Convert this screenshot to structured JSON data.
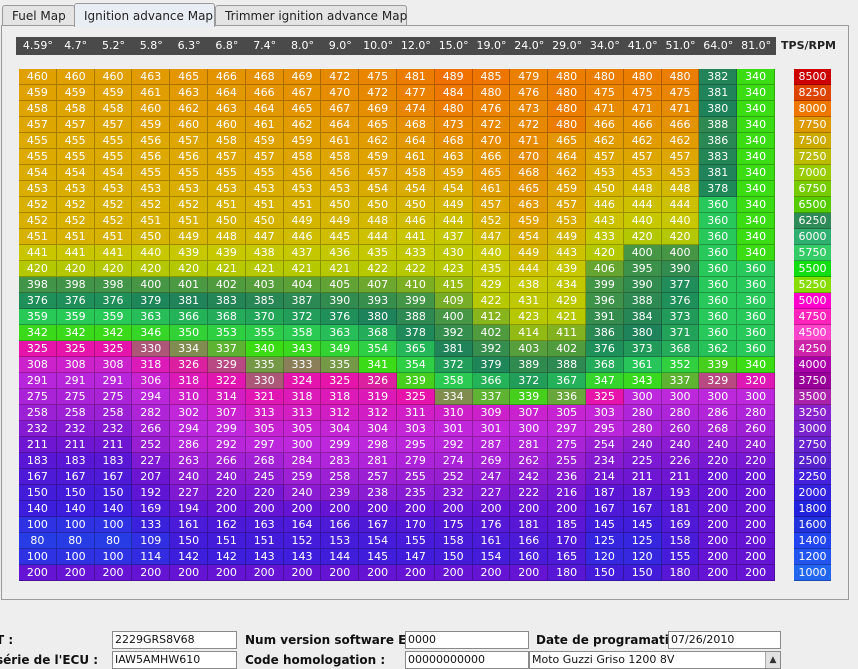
{
  "tabs": [
    {
      "label": "Fuel Map",
      "active": false
    },
    {
      "label": "Ignition advance Map",
      "active": true
    },
    {
      "label": "Trimmer ignition advance Map",
      "active": false
    }
  ],
  "axis_label": "TPS/RPM",
  "tps_header": [
    "4.59°",
    "4.7°",
    "5.2°",
    "5.8°",
    "6.3°",
    "6.8°",
    "7.4°",
    "8.0°",
    "9.0°",
    "10.0°",
    "12.0°",
    "15.0°",
    "19.0°",
    "24.0°",
    "29.0°",
    "34.0°",
    "41.0°",
    "51.0°",
    "64.0°",
    "81.0°"
  ],
  "rpm": [
    "8500",
    "8250",
    "8000",
    "7750",
    "7500",
    "7250",
    "7000",
    "6750",
    "6500",
    "6250",
    "6000",
    "5750",
    "5500",
    "5250",
    "5000",
    "4750",
    "4500",
    "4250",
    "4000",
    "3750",
    "3500",
    "3250",
    "3000",
    "2750",
    "2500",
    "2250",
    "2000",
    "1800",
    "1600",
    "1400",
    "1200",
    "1000"
  ],
  "rpm_colors": [
    "#cc0000",
    "#dd4400",
    "#ee7700",
    "#dd9900",
    "#ccaa00",
    "#bbbb00",
    "#99cc00",
    "#77cc00",
    "#55cc00",
    "#2e8b57",
    "#30b070",
    "#33cc66",
    "#11dd11",
    "#88dd00",
    "#ff00cc",
    "#ff22bb",
    "#ff44cc",
    "#cc22aa",
    "#aa00aa",
    "#990099",
    "#aa22aa",
    "#8822cc",
    "#7722cc",
    "#6622cc",
    "#5522cc",
    "#4422dd",
    "#3322dd",
    "#2222dd",
    "#2233dd",
    "#2244ee",
    "#2255ee",
    "#2266ee"
  ],
  "grid": [
    [
      460,
      460,
      460,
      463,
      465,
      466,
      468,
      469,
      472,
      475,
      481,
      489,
      485,
      479,
      480,
      480,
      480,
      480,
      382,
      340
    ],
    [
      459,
      459,
      459,
      461,
      463,
      464,
      466,
      467,
      470,
      472,
      477,
      484,
      480,
      476,
      480,
      475,
      475,
      475,
      381,
      340
    ],
    [
      458,
      458,
      458,
      460,
      462,
      463,
      464,
      465,
      467,
      469,
      474,
      480,
      476,
      473,
      480,
      471,
      471,
      471,
      380,
      340
    ],
    [
      457,
      457,
      457,
      459,
      460,
      460,
      461,
      462,
      464,
      465,
      468,
      473,
      472,
      472,
      480,
      466,
      466,
      466,
      388,
      340
    ],
    [
      455,
      455,
      455,
      456,
      457,
      458,
      459,
      459,
      461,
      462,
      464,
      468,
      470,
      471,
      465,
      462,
      462,
      462,
      386,
      340
    ],
    [
      455,
      455,
      455,
      456,
      456,
      457,
      457,
      458,
      458,
      459,
      461,
      463,
      466,
      470,
      464,
      457,
      457,
      457,
      383,
      340
    ],
    [
      454,
      454,
      454,
      455,
      455,
      455,
      455,
      456,
      456,
      457,
      458,
      459,
      465,
      468,
      462,
      453,
      453,
      453,
      381,
      340
    ],
    [
      453,
      453,
      453,
      453,
      453,
      453,
      453,
      453,
      453,
      454,
      454,
      454,
      461,
      465,
      459,
      450,
      448,
      448,
      378,
      340
    ],
    [
      452,
      452,
      452,
      452,
      452,
      451,
      451,
      451,
      450,
      450,
      450,
      449,
      457,
      463,
      457,
      446,
      444,
      444,
      360,
      340
    ],
    [
      452,
      452,
      452,
      451,
      451,
      450,
      450,
      449,
      449,
      448,
      446,
      444,
      452,
      459,
      453,
      443,
      440,
      440,
      360,
      340
    ],
    [
      451,
      451,
      451,
      450,
      449,
      448,
      447,
      446,
      445,
      444,
      441,
      437,
      447,
      454,
      449,
      433,
      420,
      420,
      360,
      340
    ],
    [
      441,
      441,
      441,
      440,
      439,
      439,
      438,
      437,
      436,
      435,
      433,
      430,
      440,
      449,
      443,
      420,
      400,
      400,
      360,
      340
    ],
    [
      420,
      420,
      420,
      420,
      420,
      421,
      421,
      421,
      421,
      422,
      422,
      423,
      435,
      444,
      439,
      406,
      395,
      390,
      360,
      360
    ],
    [
      398,
      398,
      398,
      400,
      401,
      402,
      403,
      404,
      405,
      407,
      410,
      415,
      429,
      438,
      434,
      399,
      390,
      377,
      360,
      360
    ],
    [
      376,
      376,
      376,
      379,
      381,
      383,
      385,
      387,
      390,
      393,
      399,
      409,
      422,
      431,
      429,
      396,
      388,
      376,
      360,
      360
    ],
    [
      359,
      359,
      359,
      363,
      366,
      368,
      370,
      372,
      376,
      380,
      388,
      400,
      412,
      423,
      421,
      391,
      384,
      373,
      360,
      360
    ],
    [
      342,
      342,
      342,
      346,
      350,
      353,
      355,
      358,
      363,
      368,
      378,
      392,
      402,
      414,
      411,
      386,
      380,
      371,
      360,
      360
    ],
    [
      325,
      325,
      325,
      330,
      334,
      337,
      340,
      343,
      349,
      354,
      365,
      381,
      392,
      403,
      402,
      376,
      373,
      368,
      362,
      360
    ],
    [
      308,
      308,
      308,
      318,
      326,
      329,
      335,
      333,
      335,
      341,
      354,
      372,
      379,
      389,
      388,
      368,
      361,
      352,
      339,
      340
    ],
    [
      291,
      291,
      291,
      306,
      318,
      322,
      330,
      324,
      325,
      326,
      339,
      358,
      366,
      372,
      367,
      347,
      343,
      337,
      329,
      320
    ],
    [
      275,
      275,
      275,
      294,
      310,
      314,
      321,
      318,
      318,
      319,
      325,
      334,
      337,
      339,
      336,
      325,
      300,
      300,
      300,
      300
    ],
    [
      258,
      258,
      258,
      282,
      302,
      307,
      313,
      313,
      312,
      312,
      311,
      310,
      309,
      307,
      305,
      303,
      280,
      280,
      286,
      280
    ],
    [
      232,
      232,
      232,
      266,
      294,
      299,
      305,
      305,
      304,
      304,
      303,
      301,
      301,
      300,
      297,
      295,
      280,
      260,
      268,
      260
    ],
    [
      211,
      211,
      211,
      252,
      286,
      292,
      297,
      300,
      299,
      298,
      295,
      292,
      287,
      281,
      275,
      254,
      240,
      240,
      240,
      240
    ],
    [
      183,
      183,
      183,
      227,
      263,
      266,
      268,
      284,
      283,
      281,
      279,
      274,
      269,
      262,
      255,
      234,
      225,
      226,
      220,
      220
    ],
    [
      167,
      167,
      167,
      207,
      240,
      240,
      245,
      259,
      258,
      257,
      255,
      252,
      247,
      242,
      236,
      214,
      211,
      211,
      200,
      200
    ],
    [
      150,
      150,
      150,
      192,
      227,
      220,
      220,
      240,
      239,
      238,
      235,
      232,
      227,
      222,
      216,
      187,
      187,
      193,
      200,
      200
    ],
    [
      140,
      140,
      140,
      169,
      194,
      200,
      200,
      200,
      200,
      200,
      200,
      200,
      200,
      200,
      200,
      167,
      167,
      181,
      200,
      200
    ],
    [
      100,
      100,
      100,
      133,
      161,
      162,
      163,
      164,
      166,
      167,
      170,
      175,
      176,
      181,
      185,
      145,
      145,
      169,
      200,
      200
    ],
    [
      80,
      80,
      80,
      109,
      150,
      151,
      151,
      152,
      153,
      154,
      155,
      158,
      161,
      166,
      170,
      125,
      125,
      158,
      200,
      200
    ],
    [
      100,
      100,
      100,
      114,
      142,
      142,
      143,
      143,
      144,
      145,
      147,
      150,
      154,
      160,
      165,
      120,
      120,
      155,
      200,
      200
    ],
    [
      200,
      200,
      200,
      200,
      200,
      200,
      200,
      200,
      200,
      200,
      200,
      200,
      200,
      200,
      180,
      150,
      150,
      180,
      200,
      200
    ]
  ],
  "footer": {
    "field1_label": "T :",
    "field1_value": "2229GRS8V68",
    "field2_label": "Num version software ECU :",
    "field2_value": "0000",
    "field3_label": "Date de programation :",
    "field3_value": "07/26/2010",
    "field4_label": "série de l'ECU :",
    "field4_value": "IAW5AMHW610",
    "field5_label": "Code homologation :",
    "field5_value": "00000000000",
    "field6_value": "Moto Guzzi Griso 1200 8V"
  }
}
